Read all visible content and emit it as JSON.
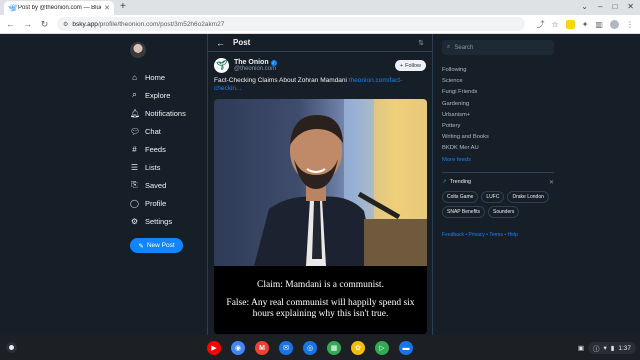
{
  "browser": {
    "tab_title": "Post by @theonion.com — Blue...",
    "url_host": "bsky.app",
    "url_path": "/profile/theonion.com/post/3m52h6o2akm27",
    "new_tab_glyph": "+"
  },
  "nav": {
    "items": [
      {
        "icon": "home-icon",
        "glyph": "⌂",
        "label": "Home"
      },
      {
        "icon": "explore-icon",
        "glyph": "⌕",
        "label": "Explore"
      },
      {
        "icon": "bell-icon",
        "glyph": "🔔︎",
        "label": "Notifications"
      },
      {
        "icon": "chat-icon",
        "glyph": "💬︎",
        "label": "Chat"
      },
      {
        "icon": "feeds-icon",
        "glyph": "#",
        "label": "Feeds"
      },
      {
        "icon": "lists-icon",
        "glyph": "☰",
        "label": "Lists"
      },
      {
        "icon": "bookmark-icon",
        "glyph": "⎘",
        "label": "Saved"
      },
      {
        "icon": "profile-icon",
        "glyph": "◯",
        "label": "Profile"
      },
      {
        "icon": "gear-icon",
        "glyph": "⚙",
        "label": "Settings"
      }
    ],
    "new_post_label": "New Post"
  },
  "post_header": {
    "title": "Post"
  },
  "post": {
    "author_name": "The Onion",
    "author_handle": "@theonion.com",
    "follow_label": "Follow",
    "text": "Fact-Checking Claims About Zohran Mamdani ",
    "link_text": "theonion.com/fact-checkin...",
    "caption_claim": "Claim: Mamdani is a communist.",
    "caption_verdict": "False: Any real communist will happily spend six hours explaining why this isn't true."
  },
  "right": {
    "search_placeholder": "Search",
    "feeds": [
      "Following",
      "Science",
      "Fungi Friends",
      "Gardening",
      "Urbanism+",
      "Pottery",
      "Writing and Books",
      "BKDK Mer AU"
    ],
    "more_feeds": "More feeds",
    "trending_title": "Trending",
    "trending": [
      "Colts Game",
      "LUFC",
      "Drake London",
      "SNAP Benefits",
      "Sounders"
    ],
    "footer": "Feedback • Privacy • Terms • Help"
  },
  "shelf": {
    "time": "1:37",
    "colors": {
      "youtube": "#ff0000",
      "chrome": "#4285f4",
      "gmail": "#ea4335",
      "messages": "#1a73e8",
      "camera": "#1a73e8",
      "sheets": "#34a853",
      "photos": "#fbbc04",
      "play": "#34a853",
      "files": "#1a73e8"
    }
  },
  "colors": {
    "accent": "#1185fe",
    "background": "#161e27"
  }
}
